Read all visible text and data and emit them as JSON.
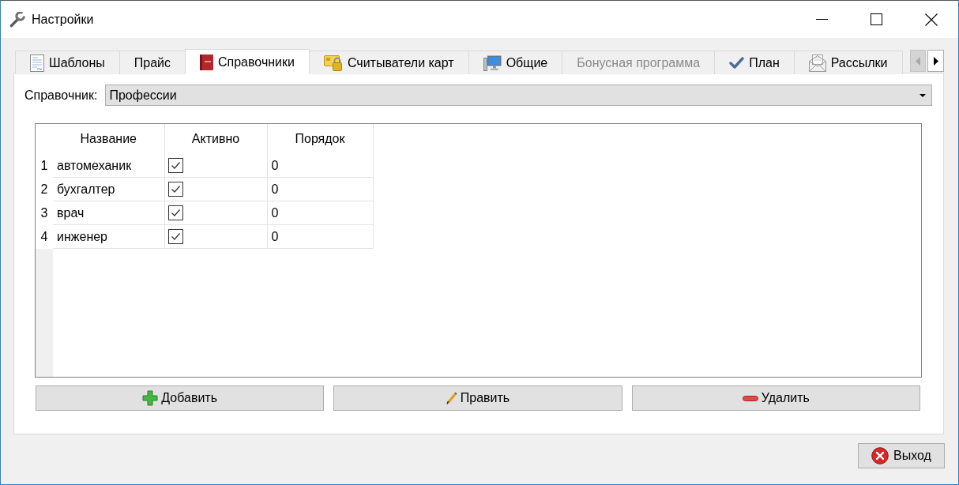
{
  "window": {
    "title": "Настройки"
  },
  "tabs": [
    {
      "label": "Шаблоны",
      "selected": false,
      "disabled": false
    },
    {
      "label": "Прайс",
      "selected": false,
      "disabled": false
    },
    {
      "label": "Справочники",
      "selected": true,
      "disabled": false
    },
    {
      "label": "Считыватели карт",
      "selected": false,
      "disabled": false
    },
    {
      "label": "Общие",
      "selected": false,
      "disabled": false
    },
    {
      "label": "Бонусная программа",
      "selected": false,
      "disabled": true
    },
    {
      "label": "План",
      "selected": false,
      "disabled": false
    },
    {
      "label": "Рассылки",
      "selected": false,
      "disabled": false
    }
  ],
  "tab_scroll": [
    {
      "kind": "left",
      "disabled": true
    },
    {
      "kind": "right",
      "disabled": false
    }
  ],
  "reference_select": {
    "label": "Справочник:",
    "value": "Профессии"
  },
  "table": {
    "columns": [
      "Название",
      "Активно",
      "Порядок"
    ],
    "rows": [
      {
        "number": "1",
        "name": "автомеханик",
        "active": true,
        "order": "0"
      },
      {
        "number": "2",
        "name": "бухгалтер",
        "active": true,
        "order": "0"
      },
      {
        "number": "3",
        "name": "врач",
        "active": true,
        "order": "0"
      },
      {
        "number": "4",
        "name": "инженер",
        "active": true,
        "order": "0"
      }
    ]
  },
  "actions": [
    {
      "label": "Добавить"
    },
    {
      "label": "Править"
    },
    {
      "label": "Удалить"
    }
  ],
  "exit_button": {
    "label": "Выход"
  }
}
